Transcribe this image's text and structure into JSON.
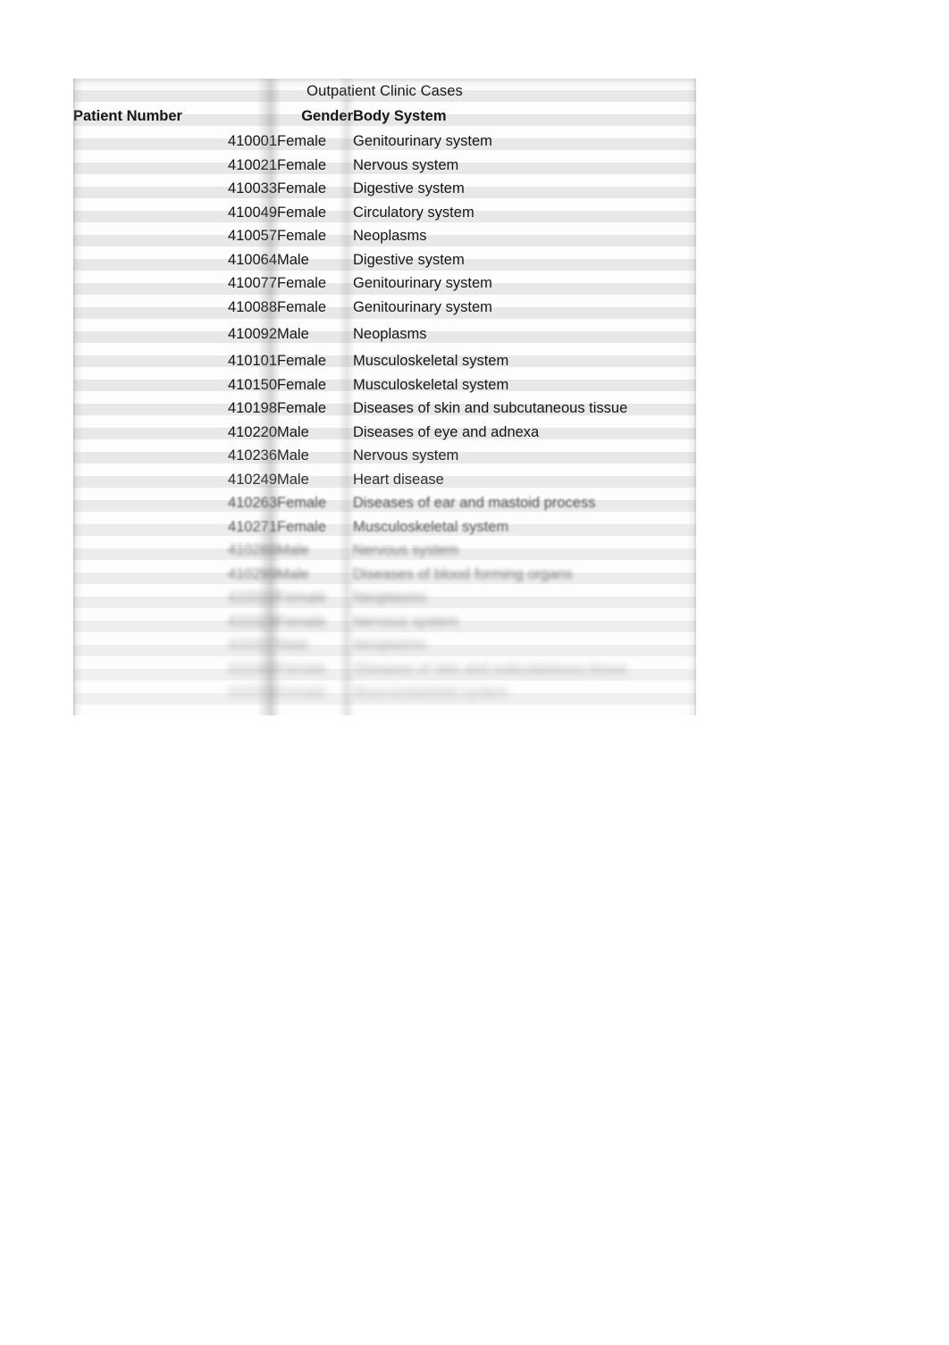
{
  "document": {
    "background_color": "#ffffff",
    "sheet_color": "#fdfdfd"
  },
  "table": {
    "title": "Outpatient Clinic Cases",
    "columns": [
      {
        "key": "patient_number",
        "label": "Patient Number",
        "align": "left"
      },
      {
        "key": "gender",
        "label": "Gender",
        "align": "right"
      },
      {
        "key": "body_system",
        "label": "Body System",
        "align": "left"
      }
    ],
    "rows": [
      {
        "patient_number": "410001",
        "gender": "Female",
        "body_system": "Genitourinary system",
        "legibility": "clear"
      },
      {
        "patient_number": "410021",
        "gender": "Female",
        "body_system": "Nervous system",
        "legibility": "clear"
      },
      {
        "patient_number": "410033",
        "gender": "Female",
        "body_system": "Digestive system",
        "legibility": "clear"
      },
      {
        "patient_number": "410049",
        "gender": "Female",
        "body_system": "Circulatory system",
        "legibility": "clear"
      },
      {
        "patient_number": "410057",
        "gender": "Female",
        "body_system": "Neoplasms",
        "legibility": "clear"
      },
      {
        "patient_number": "410064",
        "gender": "Male",
        "body_system": "Digestive system",
        "legibility": "clear"
      },
      {
        "patient_number": "410077",
        "gender": "Female",
        "body_system": "Genitourinary system",
        "legibility": "clear"
      },
      {
        "patient_number": "410088",
        "gender": "Female",
        "body_system": "Genitourinary system",
        "legibility": "clear"
      },
      {
        "patient_number": "410092",
        "gender": "Male",
        "body_system": "Neoplasms",
        "legibility": "clear"
      },
      {
        "patient_number": "410101",
        "gender": "Female",
        "body_system": "Musculoskeletal system",
        "legibility": "clear"
      },
      {
        "patient_number": "410150",
        "gender": "Female",
        "body_system": "Musculoskeletal system",
        "legibility": "clear"
      },
      {
        "patient_number": "410198",
        "gender": "Female",
        "body_system": "Diseases of skin and subcutaneous tissue",
        "legibility": "clear"
      },
      {
        "patient_number": "410220",
        "gender": "Male",
        "body_system": "Diseases of eye and adnexa",
        "legibility": "clear"
      },
      {
        "patient_number": "410236",
        "gender": "Male",
        "body_system": "Nervous system",
        "legibility": "blurred"
      },
      {
        "patient_number": "410249",
        "gender": "Male",
        "body_system": "Heart disease",
        "legibility": "blurred"
      },
      {
        "patient_number": "410263",
        "gender": "Female",
        "body_system": "Diseases of ear and mastoid process",
        "legibility": "blurred"
      },
      {
        "patient_number": "410271",
        "gender": "Female",
        "body_system": "Musculoskeletal system",
        "legibility": "blurred"
      },
      {
        "patient_number": "410288",
        "gender": "Male",
        "body_system": "Nervous system",
        "legibility": "blurred"
      },
      {
        "patient_number": "410299",
        "gender": "Male",
        "body_system": "Diseases of blood forming organs",
        "legibility": "blurred"
      },
      {
        "patient_number": "410310",
        "gender": "Female",
        "body_system": "Neoplasms",
        "legibility": "blurred"
      },
      {
        "patient_number": "410328",
        "gender": "Female",
        "body_system": "Nervous system",
        "legibility": "blurred"
      },
      {
        "patient_number": "410337",
        "gender": "Male",
        "body_system": "Neoplasms",
        "legibility": "blurred"
      },
      {
        "patient_number": "410345",
        "gender": "Female",
        "body_system": "Diseases of skin and subcutaneous tissue",
        "legibility": "blurred"
      },
      {
        "patient_number": "410358",
        "gender": "Female",
        "body_system": "Musculoskeletal system",
        "legibility": "blurred"
      }
    ]
  }
}
